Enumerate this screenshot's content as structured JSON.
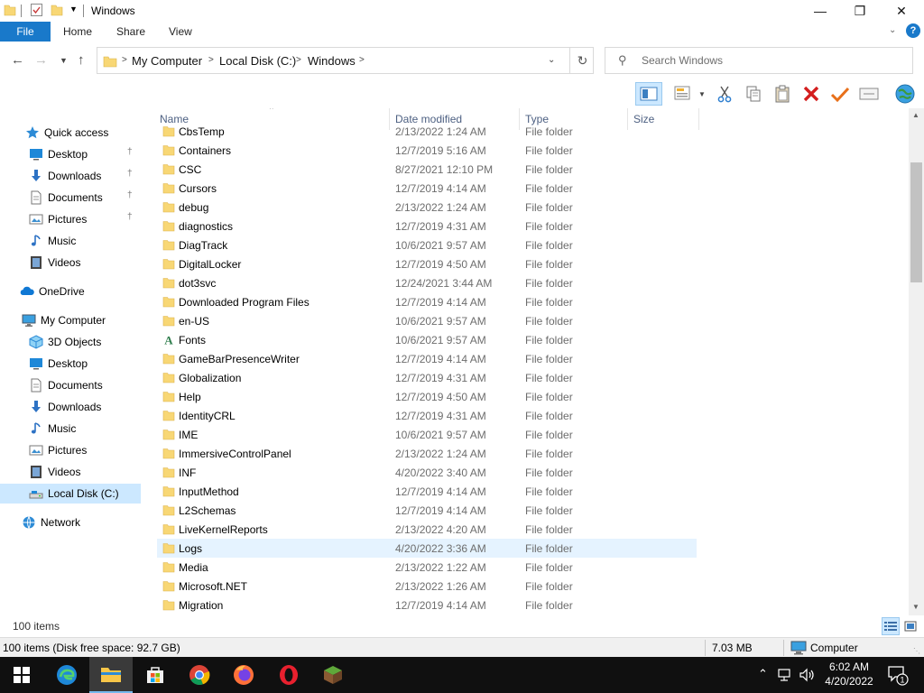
{
  "window": {
    "title": "Windows",
    "controls": {
      "minimize": "—",
      "maximize": "❐",
      "close": "✕"
    }
  },
  "ribbon": {
    "file": "File",
    "tabs": [
      "Home",
      "Share",
      "View"
    ],
    "help": "?"
  },
  "address": {
    "crumbs": [
      "My Computer",
      "Local Disk (C:)",
      "Windows"
    ]
  },
  "search": {
    "placeholder": "Search Windows"
  },
  "nav": {
    "items": [
      {
        "label": "Quick access",
        "icon": "star-icon",
        "pinned": false
      },
      {
        "label": "Desktop",
        "icon": "desktop-icon",
        "pinned": true
      },
      {
        "label": "Downloads",
        "icon": "downloads-icon",
        "pinned": true
      },
      {
        "label": "Documents",
        "icon": "documents-icon",
        "pinned": true
      },
      {
        "label": "Pictures",
        "icon": "pictures-icon",
        "pinned": true
      },
      {
        "label": "Music",
        "icon": "music-icon",
        "pinned": false
      },
      {
        "label": "Videos",
        "icon": "videos-icon",
        "pinned": false
      },
      {
        "label": "OneDrive",
        "icon": "onedrive-icon",
        "pinned": false
      },
      {
        "label": "My Computer",
        "icon": "computer-icon",
        "pinned": false
      },
      {
        "label": "3D Objects",
        "icon": "3d-objects-icon",
        "pinned": false
      },
      {
        "label": "Desktop",
        "icon": "desktop-icon",
        "pinned": false
      },
      {
        "label": "Documents",
        "icon": "documents-icon",
        "pinned": false
      },
      {
        "label": "Downloads",
        "icon": "downloads-icon",
        "pinned": false
      },
      {
        "label": "Music",
        "icon": "music-icon",
        "pinned": false
      },
      {
        "label": "Pictures",
        "icon": "pictures-icon",
        "pinned": false
      },
      {
        "label": "Videos",
        "icon": "videos-icon",
        "pinned": false
      },
      {
        "label": "Local Disk (C:)",
        "icon": "drive-icon",
        "pinned": false,
        "selected": true
      },
      {
        "label": "Network",
        "icon": "network-icon",
        "pinned": false
      }
    ]
  },
  "columns": {
    "name": "Name",
    "date": "Date modified",
    "type": "Type",
    "size": "Size"
  },
  "files": [
    {
      "name": "CbsTemp",
      "date": "2/13/2022 1:24 AM",
      "type": "File folder"
    },
    {
      "name": "Containers",
      "date": "12/7/2019 5:16 AM",
      "type": "File folder"
    },
    {
      "name": "CSC",
      "date": "8/27/2021 12:10 PM",
      "type": "File folder"
    },
    {
      "name": "Cursors",
      "date": "12/7/2019 4:14 AM",
      "type": "File folder"
    },
    {
      "name": "debug",
      "date": "2/13/2022 1:24 AM",
      "type": "File folder"
    },
    {
      "name": "diagnostics",
      "date": "12/7/2019 4:31 AM",
      "type": "File folder"
    },
    {
      "name": "DiagTrack",
      "date": "10/6/2021 9:57 AM",
      "type": "File folder"
    },
    {
      "name": "DigitalLocker",
      "date": "12/7/2019 4:50 AM",
      "type": "File folder"
    },
    {
      "name": "dot3svc",
      "date": "12/24/2021 3:44 AM",
      "type": "File folder"
    },
    {
      "name": "Downloaded Program Files",
      "date": "12/7/2019 4:14 AM",
      "type": "File folder"
    },
    {
      "name": "en-US",
      "date": "10/6/2021 9:57 AM",
      "type": "File folder"
    },
    {
      "name": "Fonts",
      "date": "10/6/2021 9:57 AM",
      "type": "File folder",
      "special": "fonts"
    },
    {
      "name": "GameBarPresenceWriter",
      "date": "12/7/2019 4:14 AM",
      "type": "File folder"
    },
    {
      "name": "Globalization",
      "date": "12/7/2019 4:31 AM",
      "type": "File folder"
    },
    {
      "name": "Help",
      "date": "12/7/2019 4:50 AM",
      "type": "File folder"
    },
    {
      "name": "IdentityCRL",
      "date": "12/7/2019 4:31 AM",
      "type": "File folder"
    },
    {
      "name": "IME",
      "date": "10/6/2021 9:57 AM",
      "type": "File folder"
    },
    {
      "name": "ImmersiveControlPanel",
      "date": "2/13/2022 1:24 AM",
      "type": "File folder"
    },
    {
      "name": "INF",
      "date": "4/20/2022 3:40 AM",
      "type": "File folder"
    },
    {
      "name": "InputMethod",
      "date": "12/7/2019 4:14 AM",
      "type": "File folder"
    },
    {
      "name": "L2Schemas",
      "date": "12/7/2019 4:14 AM",
      "type": "File folder"
    },
    {
      "name": "LiveKernelReports",
      "date": "2/13/2022 4:20 AM",
      "type": "File folder"
    },
    {
      "name": "Logs",
      "date": "4/20/2022 3:36 AM",
      "type": "File folder",
      "hover": true
    },
    {
      "name": "Media",
      "date": "2/13/2022 1:22 AM",
      "type": "File folder"
    },
    {
      "name": "Microsoft.NET",
      "date": "2/13/2022 1:26 AM",
      "type": "File folder"
    },
    {
      "name": "Migration",
      "date": "12/7/2019 4:14 AM",
      "type": "File folder"
    }
  ],
  "status": {
    "item_count": "100 items"
  },
  "details": {
    "text": "100 items (Disk free space: 92.7 GB)",
    "size": "7.03 MB",
    "location": "Computer"
  },
  "taskbar": {
    "clock_time": "6:02 AM",
    "clock_date": "4/20/2022",
    "notification_count": "1"
  },
  "colors": {
    "accent": "#1979ca",
    "folder": "#f8d775",
    "selection": "#cce8ff",
    "hover": "#e5f3ff",
    "taskbar": "#101010"
  }
}
